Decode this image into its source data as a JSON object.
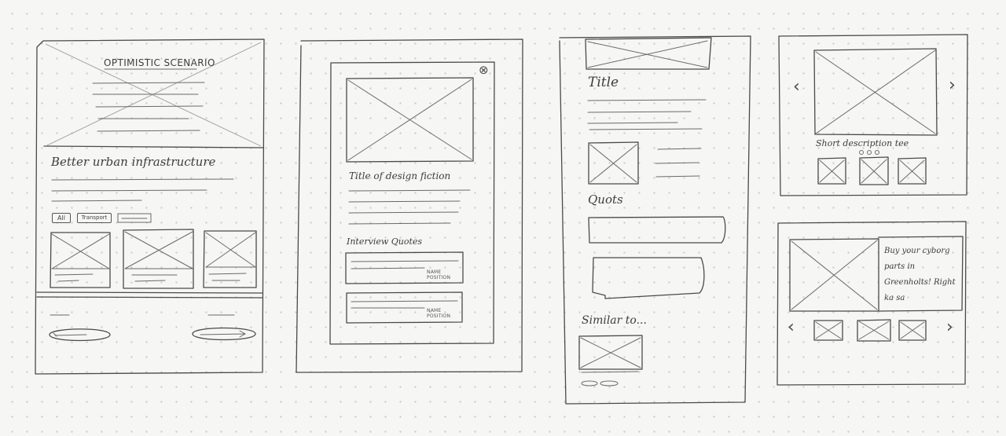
{
  "sketch1": {
    "hero_title": "OPTIMISTIC SCENARIO",
    "section_heading": "Better urban infrastructure",
    "filter_all": "All",
    "filter_2": "Transport"
  },
  "sketch2": {
    "close_glyph": "⊗",
    "title": "Title of design fiction",
    "quotes_heading": "Interview Quotes",
    "quote_1_attr": "NAME\nPOSITION",
    "quote_2_attr": "NAME\nPOSITION"
  },
  "sketch3": {
    "title": "Title",
    "quotes_heading": "Quots",
    "similar_heading": "Similar to..."
  },
  "sketch4": {
    "prev_glyph": "‹",
    "next_glyph": "›",
    "short_description": "Short description tee"
  },
  "sketch5": {
    "prev_glyph": "‹",
    "next_glyph": "›",
    "promo_text": "Buy your cyborg parts in Greenholts! Right ka sa"
  }
}
